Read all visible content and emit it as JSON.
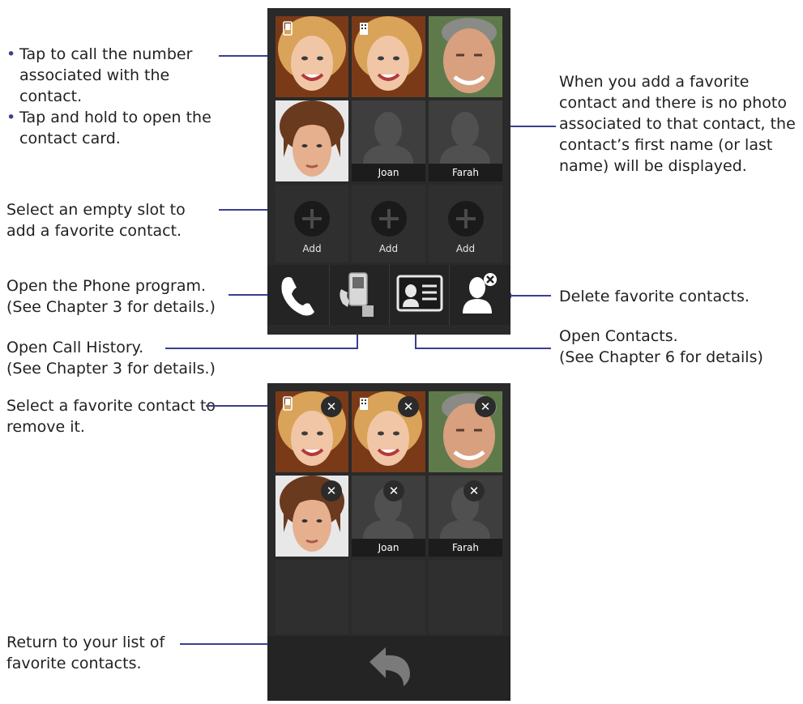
{
  "callouts": {
    "tap_call": "Tap to call the number associated with the contact.",
    "tap_hold": "Tap and hold to open the contact card.",
    "no_photo": "When you add a favorite contact and there is no photo associated to that contact, the contact’s first name (or last name) will be displayed.",
    "empty_slot": "Select an empty slot to add a favorite contact.",
    "phone_program_1": "Open the Phone program.",
    "phone_program_2": "(See Chapter 3 for details.)",
    "delete_fav": "Delete favorite contacts.",
    "call_history_1": "Open Call History.",
    "call_history_2": "(See Chapter 3 for details.)",
    "open_contacts_1": "Open Contacts.",
    "open_contacts_2": "(See Chapter 6 for details)",
    "remove_fav": "Select a favorite contact to remove it.",
    "return_list": "Return to your list of favorite contacts."
  },
  "contacts": {
    "joan": "Joan",
    "farah": "Farah"
  },
  "add_label": "Add",
  "remove_glyph": "✕",
  "colors": {
    "callout_line": "#3a3f8f",
    "screen_bg": "#2a2a2a",
    "cell_bg": "#3a3a3a"
  }
}
